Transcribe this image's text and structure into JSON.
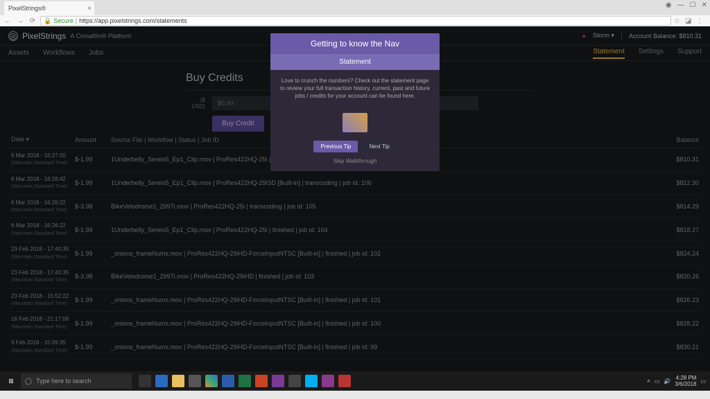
{
  "browser": {
    "tab_title": "PixelStrings®",
    "secure_label": "Secure",
    "url": "https://app.pixelstrings.com/statements"
  },
  "header": {
    "brand": "PixelStrings",
    "sub_brand": "A Cinnafilm® Platform",
    "user_label": "Storm",
    "balance_label": "Account Balance: $810.31"
  },
  "nav": {
    "left": [
      "Assets",
      "Workflows",
      "Jobs"
    ],
    "right": [
      "Statement",
      "Settings",
      "Support"
    ]
  },
  "buy": {
    "title": "Buy Credits",
    "currency_label": "($ USD)",
    "placeholder": "$0.00",
    "button": "Buy Credit"
  },
  "table": {
    "headers": {
      "date": "Date ▾",
      "amount": "Amount",
      "file": "Source File | Workflow | Status | Job ID",
      "balance": "Balance"
    },
    "tz": "(Mountain Standard Time)",
    "rows": [
      {
        "date": "6 Mar 2018 - 16:27:00",
        "amount": "$-1.99",
        "file": "1Underbelly_Sereis5_Ep1_Clip.mov | ProRes422HQ-25i | queued | job id:",
        "balance": "$810.31"
      },
      {
        "date": "6 Mar 2018 - 16:26:42",
        "amount": "$-1.99",
        "file": "1Underbelly_Sereis5_Ep1_Clip.mov | ProRes422HQ-29iSD [Built-in] | transcoding | job id: 106",
        "balance": "$812.30"
      },
      {
        "date": "6 Mar 2018 - 16:26:22",
        "amount": "$-3.98",
        "file": "BikeVelodrome1_2997i.mov | ProRes422HQ-25i | transcoding | job id: 105",
        "balance": "$814.29"
      },
      {
        "date": "6 Mar 2018 - 16:26:22",
        "amount": "$-1.99",
        "file": "1Underbelly_Sereis5_Ep1_Clip.mov | ProRes422HQ-25i | finished | job id: 104",
        "balance": "$818.27"
      },
      {
        "date": "23 Feb 2018 - 17:40:35",
        "amount": "$-1.99",
        "file": "_onions_frameNums.mov | ProRes422HQ-29iHD-ForceInputNTSC [Built-in] | finished | job id: 102",
        "balance": "$824.24"
      },
      {
        "date": "23 Feb 2018 - 17:40:35",
        "amount": "$-3.98",
        "file": "BikeVelodrome1_2997i.mov | ProRes422HQ-29iHD | finished | job id: 103",
        "balance": "$820.26"
      },
      {
        "date": "23 Feb 2018 - 15:52:22",
        "amount": "$-1.99",
        "file": "_onions_frameNums.mov | ProRes422HQ-29iHD-ForceInputNTSC [Built-in] | finished | job id: 101",
        "balance": "$826.23"
      },
      {
        "date": "16 Feb 2018 - 21:17:08",
        "amount": "$-1.99",
        "file": "_onions_frameNums.mov | ProRes422HQ-29iHD-ForceInputNTSC [Built-in] | finished | job id: 100",
        "balance": "$828.22"
      },
      {
        "date": "9 Feb 2018 - 15:09:35",
        "amount": "$-1.99",
        "file": "_onions_frameNums.mov | ProRes422HQ-29iHD-ForceInputNTSC [Built-in] | finished | job id: 99",
        "balance": "$830.21"
      }
    ]
  },
  "modal": {
    "title": "Getting to know the Nav",
    "subtitle": "Statement",
    "body": "Love to crunch the numbers? Check out the statement page to review your full transaction history, current, past and future jobs / credits for your account can be found here.",
    "prev": "Previous Tip",
    "next": "Next Tip",
    "skip": "Skip Walkthrough"
  },
  "taskbar": {
    "search_placeholder": "Type here to search",
    "time": "4:28 PM",
    "date": "3/6/2018"
  }
}
